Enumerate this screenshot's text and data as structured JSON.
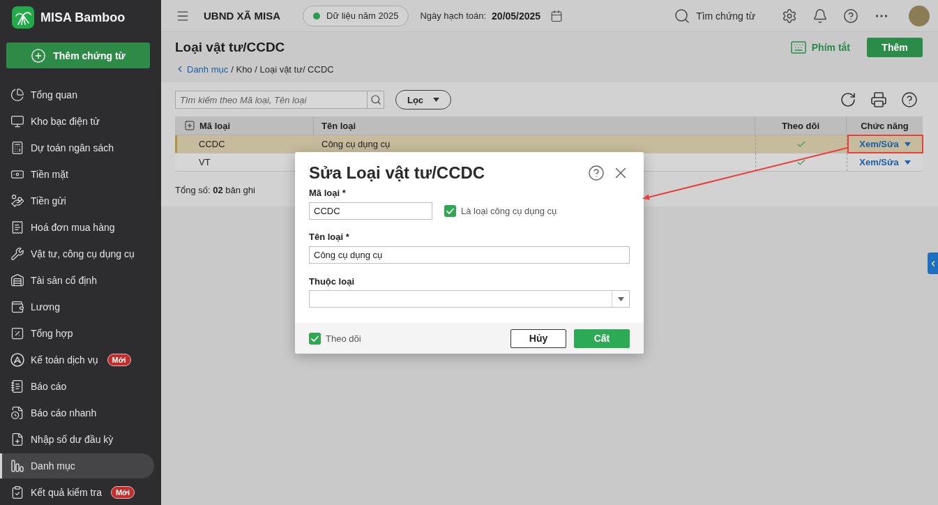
{
  "sidebar": {
    "app_name": "MISA Bamboo",
    "add_button": "Thêm chứng từ",
    "items": [
      {
        "label": "Tổng quan",
        "selected": false
      },
      {
        "label": "Kho bạc điện tử",
        "selected": false
      },
      {
        "label": "Dự toán ngân sách",
        "selected": false
      },
      {
        "label": "Tiền mặt",
        "selected": false
      },
      {
        "label": "Tiền gửi",
        "selected": false
      },
      {
        "label": "Hoá đơn mua hàng",
        "selected": false
      },
      {
        "label": "Vật tư, công cụ dụng cụ",
        "selected": false
      },
      {
        "label": "Tài sản cố định",
        "selected": false
      },
      {
        "label": "Lương",
        "selected": false
      },
      {
        "label": "Tổng hợp",
        "selected": false
      },
      {
        "label": "Kế toán dịch vụ",
        "badge": "Mới",
        "selected": false
      },
      {
        "label": "Báo cáo",
        "selected": false
      },
      {
        "label": "Báo cáo nhanh",
        "selected": false
      },
      {
        "label": "Nhập số dư đầu kỳ",
        "selected": false
      },
      {
        "label": "Danh mục",
        "selected": true
      },
      {
        "label": "Kết quả kiểm tra",
        "badge": "Mới",
        "selected": false
      }
    ]
  },
  "top_bar": {
    "organization": "UBND XÃ MISA",
    "data_year": "Dữ liệu năm 2025",
    "posting_date_label": "Ngày hạch toán:",
    "posting_date": "20/05/2025",
    "search_label": "Tìm chứng từ"
  },
  "page": {
    "title": "Loại vật tư/CCDC",
    "breadcrumb": {
      "back": "Danh mục",
      "trail": "/ Kho / Loại vật tư/ CCDC"
    },
    "shortcuts": "Phím tắt",
    "add_button": "Thêm"
  },
  "toolbar": {
    "search": {
      "placeholder": "Tìm kiếm theo Mã loại, Tên loại"
    },
    "filter": "Lọc"
  },
  "table": {
    "columns": [
      "Mã loại",
      "Tên loại",
      "Theo dõi",
      "Chức năng"
    ],
    "rows": [
      {
        "code": "CCDC",
        "name": "Công cụ dụng cụ",
        "tracked": true,
        "action": "Xem/Sửa",
        "selected": true,
        "highlighted": true
      },
      {
        "code": "VT",
        "tracked": true,
        "action": "Xem/Sửa",
        "selected": false,
        "highlighted": false
      }
    ]
  },
  "total": "Tổng số: **02** bản ghi",
  "dialog": {
    "title": "Sửa Loại vật tư/CCDC",
    "code": {
      "label": "Mã loại *",
      "value": "CCDC"
    },
    "tool_type": {
      "label": "Là loại công cụ dụng cụ",
      "checked": true
    },
    "name": {
      "label": "Tên loại *",
      "value": "Công cụ dụng cụ"
    },
    "parent": {
      "label": "Thuộc loại"
    },
    "tracked": {
      "label": "Theo dõi",
      "checked": true
    },
    "buttons": [
      {
        "label": "Hủy",
        "kind": "secondary"
      },
      {
        "label": "Cất",
        "kind": "primary"
      }
    ]
  },
  "callout_arrow": true
}
